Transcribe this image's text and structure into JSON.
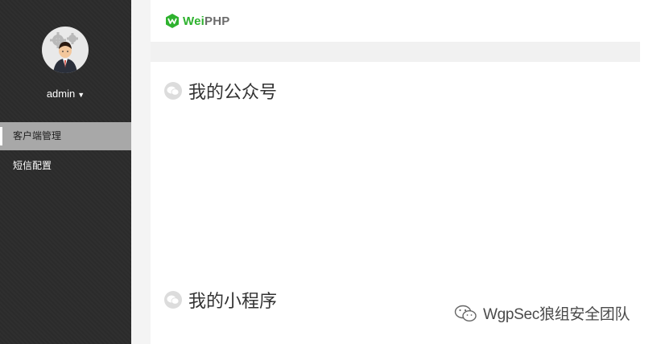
{
  "sidebar": {
    "username": "admin",
    "menu": [
      {
        "label": "客户端管理",
        "active": true
      },
      {
        "label": "短信配置",
        "active": false
      }
    ]
  },
  "header": {
    "logo_wei": "Wei",
    "logo_php": "PHP"
  },
  "main": {
    "sections": [
      {
        "title": "我的公众号"
      },
      {
        "title": "我的小程序"
      }
    ]
  },
  "watermark": {
    "text": "WgpSec狼组安全团队"
  },
  "colors": {
    "sidebar_bg": "#2b2b2b",
    "active_item_bg": "#a8a8a8",
    "brand_green": "#2eb22e"
  }
}
